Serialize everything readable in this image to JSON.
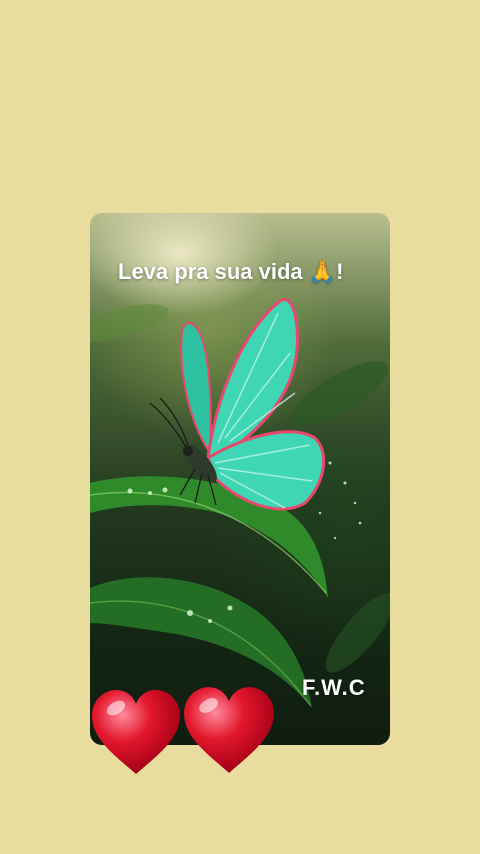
{
  "card": {
    "caption": "Leva pra sua vida 🙏!",
    "signature": "F.W.C"
  },
  "colors": {
    "background": "#e8dc9e",
    "butterfly_wing": "#3fd6b4",
    "wing_edge": "#e8476e",
    "leaf": "#2f8a2a",
    "heart": "#e3172c"
  },
  "icons": [
    "butterfly-illustration",
    "leaf-illustration",
    "heart-icon",
    "heart-icon"
  ]
}
